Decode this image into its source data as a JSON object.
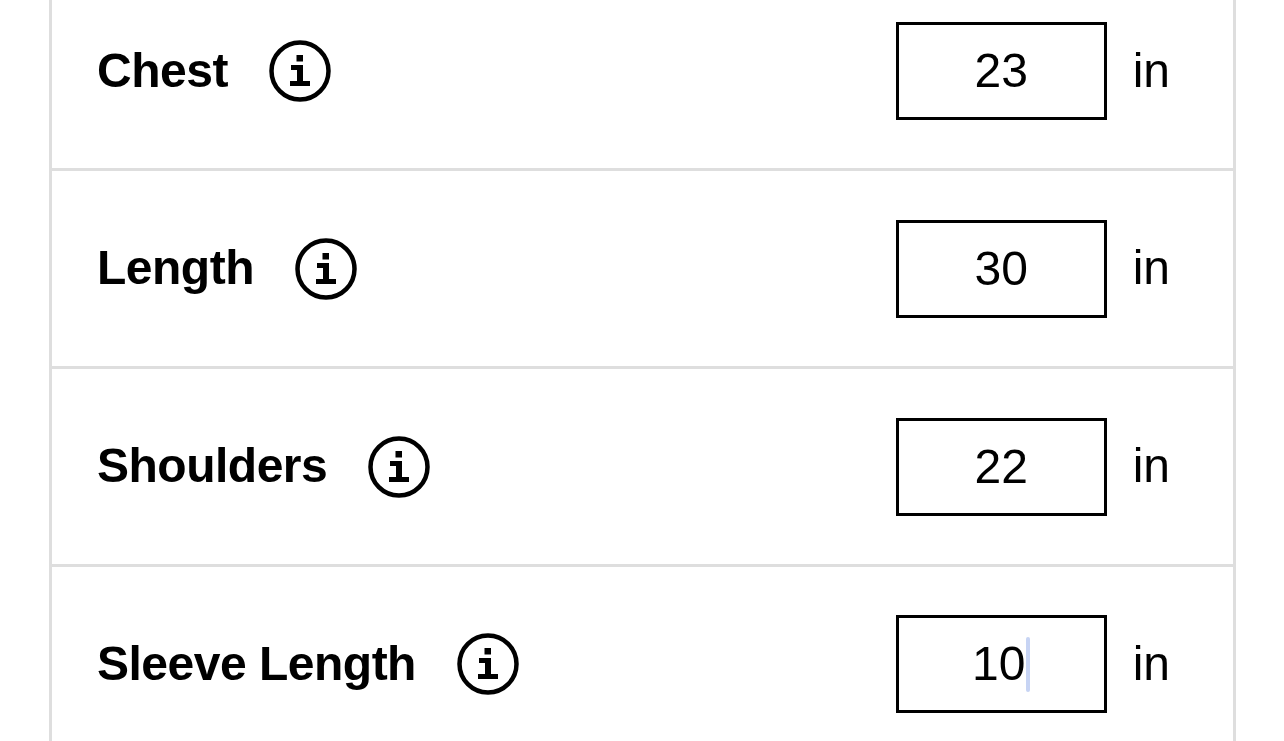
{
  "measurements": [
    {
      "label": "Chest",
      "value": "23",
      "unit": "in",
      "focused": false
    },
    {
      "label": "Length",
      "value": "30",
      "unit": "in",
      "focused": false
    },
    {
      "label": "Shoulders",
      "value": "22",
      "unit": "in",
      "focused": false
    },
    {
      "label": "Sleeve Length",
      "value": "10",
      "unit": "in",
      "focused": true
    }
  ]
}
